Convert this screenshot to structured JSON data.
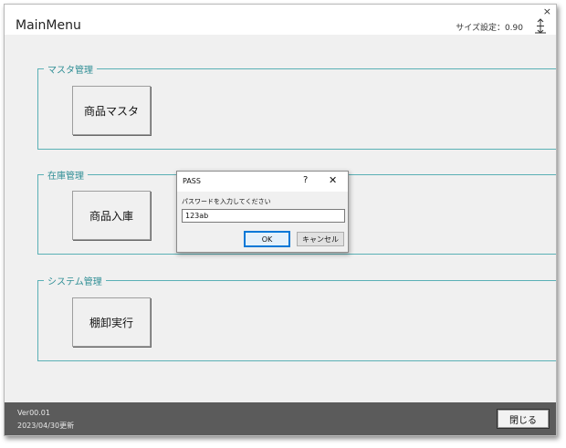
{
  "window": {
    "title": "MainMenu",
    "close_glyph": "×",
    "size_setting_label": "サイズ設定：0.90",
    "size_control_icon": "spin-arrows-icon"
  },
  "sections": [
    {
      "legend": "マスタ管理",
      "button": "商品マスタ"
    },
    {
      "legend": "在庫管理",
      "button": "商品入庫"
    },
    {
      "legend": "システム管理",
      "button": "棚卸実行"
    }
  ],
  "status_bar": {
    "version": "Ver00.01",
    "updated": "2023/04/30更新",
    "close_button": "閉じる"
  },
  "dialog": {
    "title": "PASS",
    "help_glyph": "?",
    "close_glyph": "✕",
    "prompt": "パスワードを入力してください",
    "input_value": "123ab",
    "ok_label": "OK",
    "cancel_label": "キャンセル"
  }
}
